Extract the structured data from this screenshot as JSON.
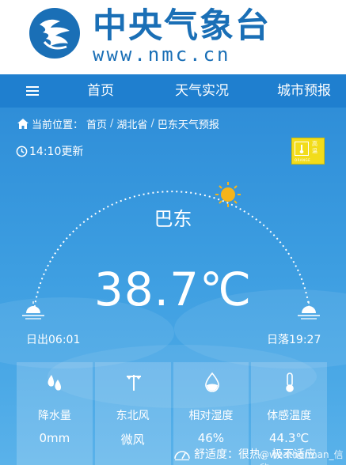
{
  "header": {
    "brand_cn": "中央气象台",
    "brand_url": "www.nmc.cn"
  },
  "nav": {
    "home": "首页",
    "live": "天气实况",
    "city": "城市预报"
  },
  "breadcrumb": {
    "prefix": "当前位置：",
    "items": [
      "首页",
      "湖北省",
      "巴东天气预报"
    ],
    "separator": "/"
  },
  "update": {
    "text": "14:10更新"
  },
  "badge": {
    "text_top": "高温",
    "text_bottom": "ORANGE"
  },
  "weather": {
    "city": "巴东",
    "temperature": "38.7℃",
    "sunrise": "日出06:01",
    "sunset": "日落19:27"
  },
  "cards": [
    {
      "icon": "raindrop-icon",
      "label": "降水量",
      "value": "0mm"
    },
    {
      "icon": "wind-vane-icon",
      "label": "东北风",
      "value": "微风"
    },
    {
      "icon": "humidity-drop-icon",
      "label": "相对湿度",
      "value": "46%"
    },
    {
      "icon": "thermometer-icon",
      "label": "体感温度",
      "value": "44.3℃"
    }
  ],
  "comfort": {
    "text": "舒适度：很热，极不适应"
  },
  "watermark": {
    "text": "@weatherman_信欣"
  },
  "colors": {
    "brand": "#1a6fb6",
    "nav": "#1f7fcf",
    "sky_top": "#2f8ed8",
    "sun": "#f5b41a",
    "badge": "#f2dc1b"
  }
}
